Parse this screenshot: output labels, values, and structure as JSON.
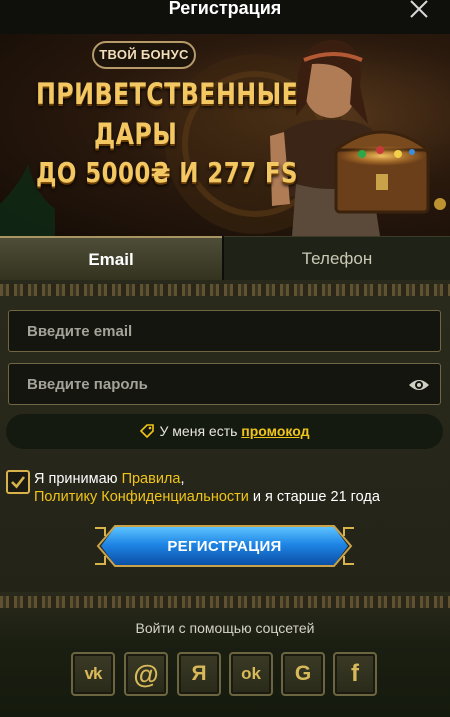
{
  "header": {
    "title": "Регистрация",
    "close_icon": "close-icon"
  },
  "banner": {
    "badge": "ТВОЙ БОНУС",
    "line1": "ПРИВЕТСТВЕННЫЕ",
    "line2": "ДАРЫ",
    "line3": "ДО 5000₴ И 277 FS"
  },
  "tabs": [
    {
      "label": "Email",
      "active": true
    },
    {
      "label": "Телефон",
      "active": false
    }
  ],
  "form": {
    "email_placeholder": "Введите email",
    "email_value": "",
    "password_placeholder": "Введите пароль",
    "password_value": "",
    "password_toggle_icon": "eye-icon",
    "promo_prefix": "У меня есть ",
    "promo_link": "промокод",
    "promo_icon": "tag-icon",
    "agree_checked": true,
    "agree_part1": "Я принимаю ",
    "agree_rules": "Правила",
    "agree_comma": ",",
    "agree_policy": "Политику Конфиденциальности",
    "agree_part2": " и я старше 21 года",
    "submit_label": "РЕГИСТРАЦИЯ"
  },
  "social": {
    "label": "Войти с помощью соцсетей",
    "providers": [
      {
        "name": "vk",
        "glyph": "vk"
      },
      {
        "name": "mail",
        "glyph": "@"
      },
      {
        "name": "yandex",
        "glyph": "Я"
      },
      {
        "name": "odnoklassniki",
        "glyph": "ok"
      },
      {
        "name": "google",
        "glyph": "G"
      },
      {
        "name": "facebook",
        "glyph": "f"
      }
    ]
  },
  "colors": {
    "accent_yellow": "#f0c419",
    "button_blue": "#1f86e6",
    "banner_gold": "#f3c863"
  }
}
